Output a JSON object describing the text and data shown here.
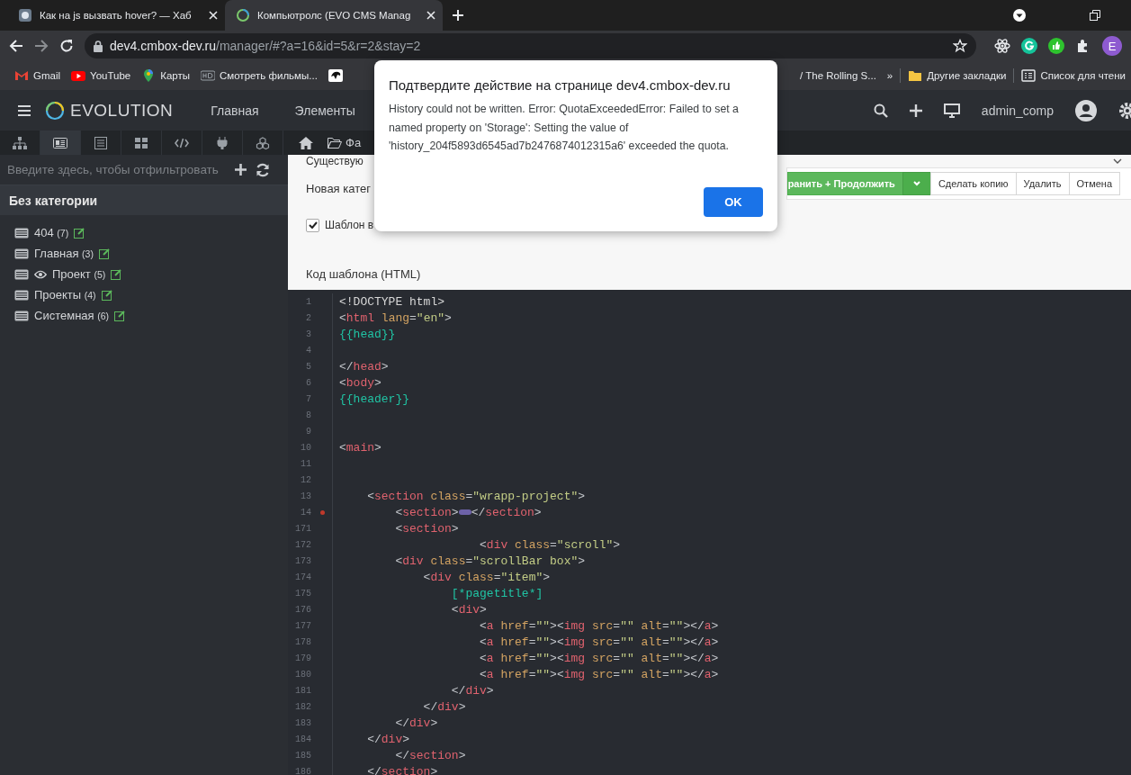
{
  "browser": {
    "tabs": [
      {
        "title": "Как на js вызвать hover? — Хаб",
        "selected": false
      },
      {
        "title": "Компьютролс (EVO CMS Manag",
        "selected": true
      }
    ],
    "url": {
      "host": "dev4.cmbox-dev.ru",
      "path": "/manager/#?a=16&id=5&r=2&stay=2"
    },
    "profile_initial": "E",
    "bookmarks_left": [
      {
        "kind": "gmail",
        "label": "Gmail"
      },
      {
        "kind": "youtube",
        "label": "YouTube"
      },
      {
        "kind": "maps",
        "label": "Карты"
      },
      {
        "kind": "hd",
        "label": "Смотреть фильмы..."
      },
      {
        "kind": "dark"
      }
    ],
    "bookmarks_right": [
      {
        "kind": "none",
        "label": "/ The Rolling S..."
      },
      {
        "kind": "more",
        "label": "»"
      },
      {
        "kind": "folder",
        "label": "Другие закладки"
      },
      {
        "kind": "reading",
        "label": "Список для чтени"
      }
    ]
  },
  "app": {
    "logo": "EVOLUTION",
    "nav": [
      "Главная",
      "Элементы"
    ],
    "user": "admin_comp"
  },
  "sidebar": {
    "tabs": [
      {
        "kind": "sitemap",
        "selected": false
      },
      {
        "kind": "templates",
        "selected": true
      },
      {
        "kind": "list",
        "selected": false
      },
      {
        "kind": "grid",
        "selected": false
      },
      {
        "kind": "code",
        "selected": false
      },
      {
        "kind": "plug",
        "selected": false
      },
      {
        "kind": "cubes",
        "selected": false
      }
    ],
    "filter": {
      "placeholder": "Введите здесь, чтобы отфильтровать"
    },
    "category": "Без категории",
    "items": [
      {
        "name": "404",
        "count": "(7)",
        "eye": false
      },
      {
        "name": "Главная",
        "count": "(3)",
        "eye": false
      },
      {
        "name": "Проект",
        "count": "(5)",
        "eye": true
      },
      {
        "name": "Проекты",
        "count": "(4)",
        "eye": false
      },
      {
        "name": "Системная",
        "count": "(6)",
        "eye": false
      }
    ]
  },
  "main_tabs": [
    {
      "kind": "home"
    },
    {
      "kind": "folder",
      "label": "Фа"
    }
  ],
  "form": {
    "existing_label": "Существую",
    "new_category_label": "Новая катег",
    "buttons": [
      {
        "kind": "primary",
        "label": "ранить + Продолжить"
      },
      {
        "kind": "dropdown"
      },
      {
        "kind": "default",
        "label": "Сделать копию"
      },
      {
        "kind": "default",
        "label": "Удалить"
      },
      {
        "kind": "default",
        "label": "Отмена"
      }
    ],
    "checkbox": {
      "label": "Шаблон в",
      "checked": true
    },
    "code_label": "Код шаблона (HTML)"
  },
  "editor": {
    "lines": [
      {
        "n": "1",
        "marked": false,
        "tokens": [
          {
            "kind": "plain",
            "text": "<!DOCTYPE html>"
          }
        ]
      },
      {
        "n": "2",
        "marked": false,
        "tokens": [
          {
            "kind": "punct",
            "text": "<"
          },
          {
            "kind": "tag",
            "text": "html"
          },
          {
            "kind": "attr",
            "text": " lang"
          },
          {
            "kind": "punct",
            "text": "="
          },
          {
            "kind": "string",
            "text": "\"en\""
          },
          {
            "kind": "punct",
            "text": ">"
          }
        ]
      },
      {
        "n": "3",
        "marked": false,
        "tokens": [
          {
            "kind": "var",
            "text": "{{head}}"
          }
        ]
      },
      {
        "n": "4",
        "marked": false
      },
      {
        "n": "5",
        "marked": false,
        "tokens": [
          {
            "kind": "punct",
            "text": "</"
          },
          {
            "kind": "tag",
            "text": "head"
          },
          {
            "kind": "punct",
            "text": ">"
          }
        ]
      },
      {
        "n": "6",
        "marked": false,
        "tokens": [
          {
            "kind": "punct",
            "text": "<"
          },
          {
            "kind": "tag",
            "text": "body"
          },
          {
            "kind": "punct",
            "text": ">"
          }
        ]
      },
      {
        "n": "7",
        "marked": false,
        "tokens": [
          {
            "kind": "var",
            "text": "{{header}}"
          }
        ]
      },
      {
        "n": "8",
        "marked": false
      },
      {
        "n": "9",
        "marked": false
      },
      {
        "n": "10",
        "marked": false,
        "tokens": [
          {
            "kind": "punct",
            "text": "<"
          },
          {
            "kind": "tag",
            "text": "main"
          },
          {
            "kind": "punct",
            "text": ">"
          }
        ]
      },
      {
        "n": "11",
        "marked": false
      },
      {
        "n": "12",
        "marked": false
      },
      {
        "n": "13",
        "marked": false,
        "tokens": [
          {
            "kind": "punct",
            "text": "    <"
          },
          {
            "kind": "tag",
            "text": "section"
          },
          {
            "kind": "attr",
            "text": " class"
          },
          {
            "kind": "punct",
            "text": "="
          },
          {
            "kind": "string",
            "text": "\"wrapp-project\""
          },
          {
            "kind": "punct",
            "text": ">"
          }
        ]
      },
      {
        "n": "14",
        "marked": true,
        "tokens": [
          {
            "kind": "punct",
            "text": "        <"
          },
          {
            "kind": "tag",
            "text": "section"
          },
          {
            "kind": "punct",
            "text": ">"
          },
          {
            "kind": "fold"
          },
          {
            "kind": "punct",
            "text": "</"
          },
          {
            "kind": "tag",
            "text": "section"
          },
          {
            "kind": "punct",
            "text": ">"
          }
        ]
      },
      {
        "n": "171",
        "marked": false,
        "tokens": [
          {
            "kind": "punct",
            "text": "        <"
          },
          {
            "kind": "tag",
            "text": "section"
          },
          {
            "kind": "punct",
            "text": ">"
          }
        ]
      },
      {
        "n": "172",
        "marked": false,
        "tokens": [
          {
            "kind": "punct",
            "text": "                    <"
          },
          {
            "kind": "tag",
            "text": "div"
          },
          {
            "kind": "attr",
            "text": " class"
          },
          {
            "kind": "punct",
            "text": "="
          },
          {
            "kind": "string",
            "text": "\"scroll\""
          },
          {
            "kind": "punct",
            "text": ">"
          }
        ]
      },
      {
        "n": "173",
        "marked": false,
        "tokens": [
          {
            "kind": "punct",
            "text": "        <"
          },
          {
            "kind": "tag",
            "text": "div"
          },
          {
            "kind": "attr",
            "text": " class"
          },
          {
            "kind": "punct",
            "text": "="
          },
          {
            "kind": "string",
            "text": "\"scrollBar box\""
          },
          {
            "kind": "punct",
            "text": ">"
          }
        ]
      },
      {
        "n": "174",
        "marked": false,
        "tokens": [
          {
            "kind": "punct",
            "text": "            <"
          },
          {
            "kind": "tag",
            "text": "div"
          },
          {
            "kind": "attr",
            "text": " class"
          },
          {
            "kind": "punct",
            "text": "="
          },
          {
            "kind": "string",
            "text": "\"item\""
          },
          {
            "kind": "punct",
            "text": ">"
          }
        ]
      },
      {
        "n": "175",
        "marked": false,
        "tokens": [
          {
            "kind": "var",
            "text": "                [*pagetitle*]"
          }
        ]
      },
      {
        "n": "176",
        "marked": false,
        "tokens": [
          {
            "kind": "punct",
            "text": "                <"
          },
          {
            "kind": "tag",
            "text": "div"
          },
          {
            "kind": "punct",
            "text": ">"
          }
        ]
      },
      {
        "n": "177",
        "marked": false,
        "tokens": [
          {
            "kind": "punct",
            "text": "                    <"
          },
          {
            "kind": "tag",
            "text": "a"
          },
          {
            "kind": "attr",
            "text": " href"
          },
          {
            "kind": "punct",
            "text": "="
          },
          {
            "kind": "string",
            "text": "\"\""
          },
          {
            "kind": "punct",
            "text": "><"
          },
          {
            "kind": "tag",
            "text": "img"
          },
          {
            "kind": "attr",
            "text": " src"
          },
          {
            "kind": "punct",
            "text": "="
          },
          {
            "kind": "string",
            "text": "\"\""
          },
          {
            "kind": "attr",
            "text": " alt"
          },
          {
            "kind": "punct",
            "text": "="
          },
          {
            "kind": "string",
            "text": "\"\""
          },
          {
            "kind": "punct",
            "text": "></"
          },
          {
            "kind": "tag",
            "text": "a"
          },
          {
            "kind": "punct",
            "text": ">"
          }
        ]
      },
      {
        "n": "178",
        "marked": false,
        "tokens": [
          {
            "kind": "punct",
            "text": "                    <"
          },
          {
            "kind": "tag",
            "text": "a"
          },
          {
            "kind": "attr",
            "text": " href"
          },
          {
            "kind": "punct",
            "text": "="
          },
          {
            "kind": "string",
            "text": "\"\""
          },
          {
            "kind": "punct",
            "text": "><"
          },
          {
            "kind": "tag",
            "text": "img"
          },
          {
            "kind": "attr",
            "text": " src"
          },
          {
            "kind": "punct",
            "text": "="
          },
          {
            "kind": "string",
            "text": "\"\""
          },
          {
            "kind": "attr",
            "text": " alt"
          },
          {
            "kind": "punct",
            "text": "="
          },
          {
            "kind": "string",
            "text": "\"\""
          },
          {
            "kind": "punct",
            "text": "></"
          },
          {
            "kind": "tag",
            "text": "a"
          },
          {
            "kind": "punct",
            "text": ">"
          }
        ]
      },
      {
        "n": "179",
        "marked": false,
        "tokens": [
          {
            "kind": "punct",
            "text": "                    <"
          },
          {
            "kind": "tag",
            "text": "a"
          },
          {
            "kind": "attr",
            "text": " href"
          },
          {
            "kind": "punct",
            "text": "="
          },
          {
            "kind": "string",
            "text": "\"\""
          },
          {
            "kind": "punct",
            "text": "><"
          },
          {
            "kind": "tag",
            "text": "img"
          },
          {
            "kind": "attr",
            "text": " src"
          },
          {
            "kind": "punct",
            "text": "="
          },
          {
            "kind": "string",
            "text": "\"\""
          },
          {
            "kind": "attr",
            "text": " alt"
          },
          {
            "kind": "punct",
            "text": "="
          },
          {
            "kind": "string",
            "text": "\"\""
          },
          {
            "kind": "punct",
            "text": "></"
          },
          {
            "kind": "tag",
            "text": "a"
          },
          {
            "kind": "punct",
            "text": ">"
          }
        ]
      },
      {
        "n": "180",
        "marked": false,
        "tokens": [
          {
            "kind": "punct",
            "text": "                    <"
          },
          {
            "kind": "tag",
            "text": "a"
          },
          {
            "kind": "attr",
            "text": " href"
          },
          {
            "kind": "punct",
            "text": "="
          },
          {
            "kind": "string",
            "text": "\"\""
          },
          {
            "kind": "punct",
            "text": "><"
          },
          {
            "kind": "tag",
            "text": "img"
          },
          {
            "kind": "attr",
            "text": " src"
          },
          {
            "kind": "punct",
            "text": "="
          },
          {
            "kind": "string",
            "text": "\"\""
          },
          {
            "kind": "attr",
            "text": " alt"
          },
          {
            "kind": "punct",
            "text": "="
          },
          {
            "kind": "string",
            "text": "\"\""
          },
          {
            "kind": "punct",
            "text": "></"
          },
          {
            "kind": "tag",
            "text": "a"
          },
          {
            "kind": "punct",
            "text": ">"
          }
        ]
      },
      {
        "n": "181",
        "marked": false,
        "tokens": [
          {
            "kind": "punct",
            "text": "                </"
          },
          {
            "kind": "tag",
            "text": "div"
          },
          {
            "kind": "punct",
            "text": ">"
          }
        ]
      },
      {
        "n": "182",
        "marked": false,
        "tokens": [
          {
            "kind": "punct",
            "text": "            </"
          },
          {
            "kind": "tag",
            "text": "div"
          },
          {
            "kind": "punct",
            "text": ">"
          }
        ]
      },
      {
        "n": "183",
        "marked": false,
        "tokens": [
          {
            "kind": "punct",
            "text": "        </"
          },
          {
            "kind": "tag",
            "text": "div"
          },
          {
            "kind": "punct",
            "text": ">"
          }
        ]
      },
      {
        "n": "184",
        "marked": false,
        "tokens": [
          {
            "kind": "punct",
            "text": "    </"
          },
          {
            "kind": "tag",
            "text": "div"
          },
          {
            "kind": "punct",
            "text": ">"
          }
        ]
      },
      {
        "n": "185",
        "marked": false,
        "tokens": [
          {
            "kind": "punct",
            "text": "        </"
          },
          {
            "kind": "tag",
            "text": "section"
          },
          {
            "kind": "punct",
            "text": ">"
          }
        ]
      },
      {
        "n": "186",
        "marked": false,
        "tokens": [
          {
            "kind": "punct",
            "text": "    </"
          },
          {
            "kind": "tag",
            "text": "section"
          },
          {
            "kind": "punct",
            "text": ">"
          }
        ]
      }
    ]
  },
  "dialog": {
    "title": "Подтвердите действие на странице dev4.cmbox-dev.ru",
    "message": "History could not be written. Error: QuotaExceededError: Failed to set a named property on 'Storage': Setting the value of 'history_204f5893d6545ad7b2476874012315a6' exceeded the quota.",
    "button": "OK"
  }
}
